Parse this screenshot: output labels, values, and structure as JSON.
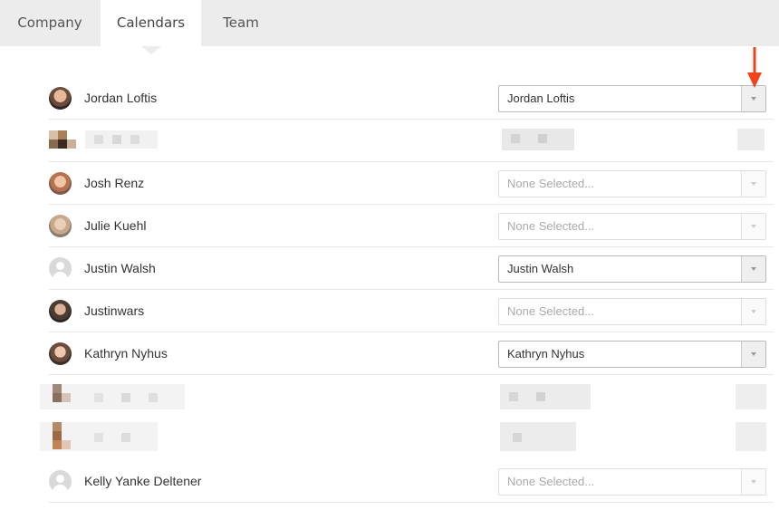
{
  "tabs": [
    {
      "label": "Company"
    },
    {
      "label": "Calendars"
    },
    {
      "label": "Team"
    }
  ],
  "rows": [
    {
      "name": "Jordan Loftis",
      "value": "Jordan Loftis",
      "state": "filled"
    },
    {
      "name": "Josh Renz",
      "value": "None Selected...",
      "state": "empty"
    },
    {
      "name": "Julie Kuehl",
      "value": "None Selected...",
      "state": "empty"
    },
    {
      "name": "Justin Walsh",
      "value": "Justin Walsh",
      "state": "filled"
    },
    {
      "name": "Justinwars",
      "value": "None Selected...",
      "state": "empty"
    },
    {
      "name": "Kathryn Nyhus",
      "value": "Kathryn Nyhus",
      "state": "filled"
    },
    {
      "name": "Kelly Yanke Deltener",
      "value": "None Selected...",
      "state": "empty"
    }
  ],
  "colors": {
    "tab_bar": "#ececec",
    "annotation_arrow": "#f0431c"
  },
  "icons": {
    "dropdown": "chevron-down-icon",
    "default_avatar": "user-silhouette-icon"
  }
}
